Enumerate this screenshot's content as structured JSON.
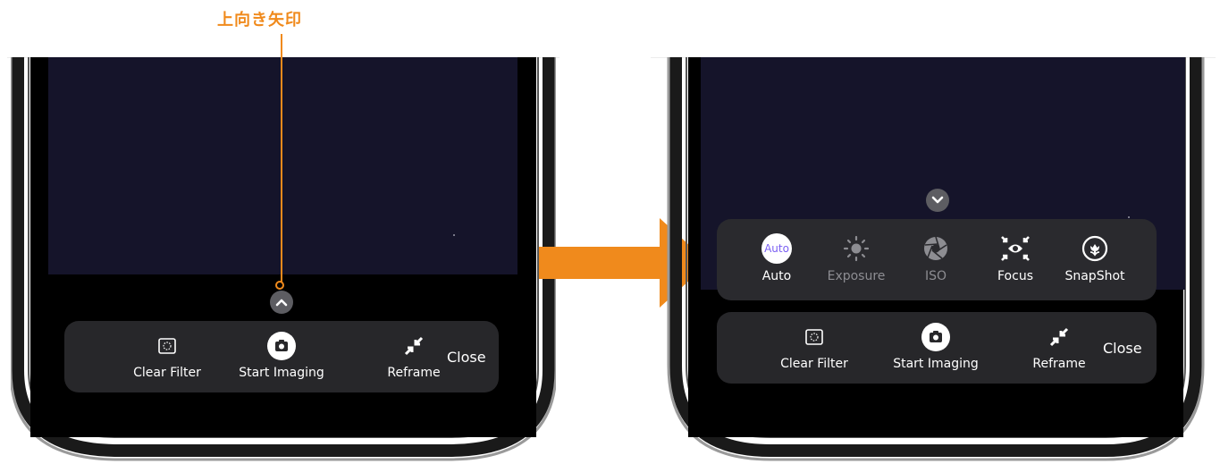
{
  "annotation": {
    "label": "上向き矢印",
    "color": "#F08A1C"
  },
  "arrow": {
    "color": "#F08A1C"
  },
  "left_screen": {
    "expand_icon": "chevron-up-icon",
    "toolbar": {
      "clear_filter": {
        "label": "Clear Filter",
        "icon": "filter-frame-icon"
      },
      "start_imaging": {
        "label": "Start Imaging",
        "icon": "camera-icon"
      },
      "reframe": {
        "label": "Reframe",
        "icon": "reframe-arrows-icon"
      },
      "close": {
        "label": "Close"
      }
    }
  },
  "right_screen": {
    "collapse_icon": "chevron-down-icon",
    "modes": [
      {
        "label": "Auto",
        "icon_text": "Auto",
        "selected": true
      },
      {
        "label": "Exposure",
        "icon": "sun-icon",
        "enabled": false
      },
      {
        "label": "ISO",
        "icon": "aperture-icon",
        "enabled": false
      },
      {
        "label": "Focus",
        "icon": "focus-icon",
        "enabled": true
      },
      {
        "label": "SnapShot",
        "icon": "flower-icon",
        "enabled": true
      }
    ],
    "toolbar": {
      "clear_filter": {
        "label": "Clear Filter",
        "icon": "filter-frame-icon"
      },
      "start_imaging": {
        "label": "Start Imaging",
        "icon": "camera-icon"
      },
      "reframe": {
        "label": "Reframe",
        "icon": "reframe-arrows-icon"
      },
      "close": {
        "label": "Close"
      }
    }
  },
  "colors": {
    "sky": "#15142A",
    "panel": "#27272A",
    "auto_accent": "#7A5FF2"
  }
}
